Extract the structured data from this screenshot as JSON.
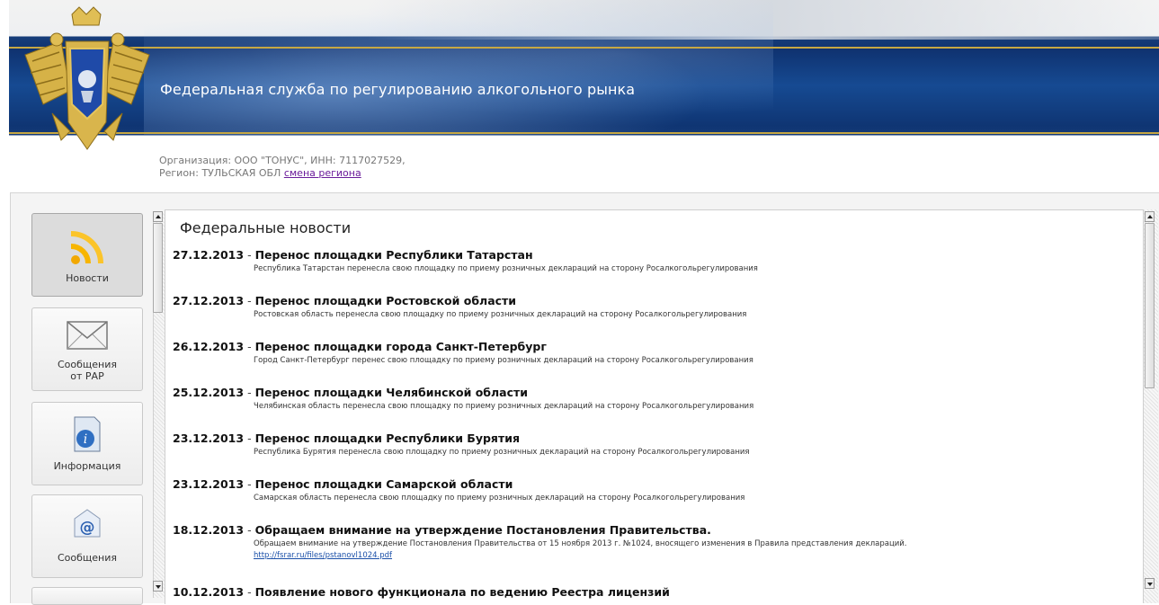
{
  "header": {
    "site_title": "Федеральная служба по регулированию алкогольного рынка",
    "org_line": "Организация: ООО \"ТОНУС\", ИНН: 7117027529,",
    "region_line": "Регион: ТУЛЬСКАЯ ОБЛ",
    "change_region_link": "смена региона",
    "emblem_icon": "double-headed-eagle-emblem-icon"
  },
  "nav": {
    "items": [
      {
        "label": "Новости",
        "icon": "rss-icon",
        "active": true
      },
      {
        "label": "Сообщения от РАР",
        "icon": "envelope-icon",
        "active": false
      },
      {
        "label": "Информация",
        "icon": "info-document-icon",
        "active": false
      },
      {
        "label": "Сообщения",
        "icon": "at-mail-icon",
        "active": false
      }
    ]
  },
  "content": {
    "section_title": "Федеральные новости",
    "news": [
      {
        "date": "27.12.2013",
        "title": "Перенос площадки Республики Татарстан",
        "desc": "Республика Татарстан перенесла свою площадку по приему розничных деклараций на сторону Росалкогольрегулирования"
      },
      {
        "date": "27.12.2013",
        "title": "Перенос площадки Ростовской области",
        "desc": "Ростовская область перенесла свою площадку по приему розничных деклараций на сторону Росалкогольрегулирования"
      },
      {
        "date": "26.12.2013",
        "title": "Перенос площадки города Санкт-Петербург",
        "desc": "Город Санкт-Петербург перенес свою площадку по приему розничных деклараций на сторону Росалкогольрегулирования"
      },
      {
        "date": "25.12.2013",
        "title": "Перенос площадки Челябинской области",
        "desc": "Челябинская область перенесла свою площадку по приему розничных деклараций на сторону Росалкогольрегулирования"
      },
      {
        "date": "23.12.2013",
        "title": "Перенос площадки Республики Бурятия",
        "desc": "Республика Бурятия перенесла свою площадку по приему розничных деклараций на сторону Росалкогольрегулирования"
      },
      {
        "date": "23.12.2013",
        "title": "Перенос площадки Самарской области",
        "desc": "Самарская область перенесла свою площадку по приему розничных деклараций на сторону Росалкогольрегулирования"
      },
      {
        "date": "18.12.2013",
        "title": "Обращаем внимание на утверждение Постановления Правительства.",
        "desc": "Обращаем внимание на утверждение Постановления Правительства от 15 ноября 2013 г. №1024, вносящего изменения в Правила представления деклараций.",
        "link": "http://fsrar.ru/files/pstanovl1024.pdf"
      },
      {
        "date": "10.12.2013",
        "title": "Появление нового функционала по ведению Реестра лицензий",
        "desc": ""
      }
    ],
    "separator": "-"
  }
}
